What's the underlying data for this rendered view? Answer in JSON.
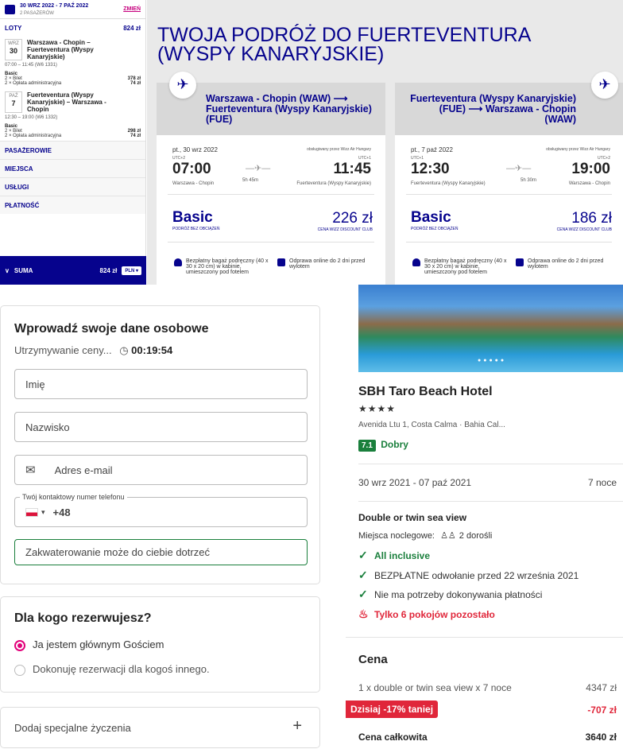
{
  "sidebar": {
    "dates": "30 WRZ 2022 - 7 PAŹ 2022",
    "passengers": "2 PASAŻERÓW",
    "change": "ZMIEŃ",
    "flights_label": "LOTY",
    "flights_total": "824 zł",
    "out": {
      "day_name": "WRZ",
      "day": "30",
      "route": "Warszawa - Chopin – Fuerteventura (Wyspy Kanaryjskie)",
      "time": "07:00 – 11:45 (W6 1331)",
      "fare": "Basic",
      "ticket": "2 × Bilet",
      "ticket_price": "378 zł",
      "fee": "2 × Opłata administracyjna",
      "fee_price": "74 zł"
    },
    "ret": {
      "day_name": "PAŹ",
      "day": "7",
      "route": "Fuerteventura (Wyspy Kanaryjskie) – Warszawa - Chopin",
      "time": "12:30 – 19:00 (W6 1332)",
      "fare": "Basic",
      "ticket": "2 × Bilet",
      "ticket_price": "298 zł",
      "fee": "2 × Opłata administracyjna",
      "fee_price": "74 zł"
    },
    "sections": [
      "PASAŻEROWIE",
      "MIEJSCA",
      "USŁUGI",
      "PŁATNOŚĆ"
    ],
    "sum_label": "SUMA",
    "sum_value": "824 zł",
    "currency": "PLN"
  },
  "trip": {
    "title": "TWOJA PODRÓŻ DO FUERTEVENTURA (WYSPY KANARYJSKIE)",
    "cards": [
      {
        "route": "Warszawa - Chopin (WAW) ⟶ Fuerteventura (Wyspy Kanaryjskie) (FUE)",
        "date": "pt., 30 wrz 2022",
        "operator": "obsługiwany przez Wizz Air Hungary",
        "tz1": "UTC+2",
        "tz2": "UTC+1",
        "dep": "07:00",
        "arr": "11:45",
        "from": "Warszawa - Chopin",
        "duration": "5h 45m",
        "to": "Fuerteventura (Wyspy Kanaryjskie)",
        "fare": "Basic",
        "fare_sub": "PODRÓŻ BEZ OBCIĄŻEŃ",
        "price": "226 zł",
        "club": "CENA WIZZ DISCOUNT CLUB",
        "bag": "Bezpłatny bagaż podręczny (40 x 30 x 20 cm) w kabinie, umieszczony pod fotelem",
        "checkin": "Odprawa online do 2 dni przed wylotem"
      },
      {
        "route": "Fuerteventura (Wyspy Kanaryjskie) (FUE) ⟶ Warszawa - Chopin (WAW)",
        "date": "pt., 7 paź 2022",
        "operator": "obsługiwany przez Wizz Air Hungary",
        "tz1": "UTC+1",
        "tz2": "UTC+2",
        "dep": "12:30",
        "arr": "19:00",
        "from": "Fuerteventura (Wyspy Kanaryjskie)",
        "duration": "5h 30m",
        "to": "Warszawa - Chopin",
        "fare": "Basic",
        "fare_sub": "PODRÓŻ BEZ OBCIĄŻEŃ",
        "price": "186 zł",
        "club": "CENA WIZZ DISCOUNT CLUB",
        "bag": "Bezpłatny bagaż podręczny (40 x 30 x 20 cm) w kabinie, umieszczony pod fotelem",
        "checkin": "Odprawa online do 2 dni przed wylotem"
      }
    ]
  },
  "form": {
    "title": "Wprowadź swoje dane osobowe",
    "hold": "Utrzymywanie ceny...",
    "timer": "00:19:54",
    "first_name": "Imię",
    "last_name": "Nazwisko",
    "email": "Adres e-mail",
    "phone_label": "Twój kontaktowy numer telefonu",
    "phone_prefix": "+48",
    "notice": "Zakwaterowanie może do ciebie dotrzeć",
    "who_title": "Dla kogo rezerwujesz?",
    "opt1": "Ja jestem głównym Gościem",
    "opt2": "Dokonuję rezerwacji dla kogoś innego.",
    "special": "Dodaj specjalne życzenia",
    "plus": "+"
  },
  "hotel": {
    "name": "SBH Taro Beach Hotel",
    "stars": "★★★★",
    "address": "Avenida Ltu 1, Costa Calma · Bahia Cal...",
    "score": "7.1",
    "score_label": "Dobry",
    "dates": "30 wrz 2021 - 07 paź 2021",
    "nights": "7 noce",
    "room": "Double or twin sea view",
    "occ_label": "Miejsca noclegowe:",
    "occ": "2 dorośli",
    "f1": "All inclusive",
    "f2": "BEZPŁATNE odwołanie przed 22 września 2021",
    "f3": "Nie ma potrzeby dokonywania płatności",
    "f4": "Tylko 6 pokojów pozostało",
    "price_title": "Cena",
    "line1": "1 x double or twin sea view x 7 noce",
    "line1_val": "4347 zł",
    "disc": "Dzisiaj -17% taniej",
    "disc_val": "-707 zł",
    "total": "Cena całkowita",
    "total_val": "3640 zł"
  },
  "colors": {
    "wizz_blue": "#06038d",
    "pink": "#c6007e",
    "green": "#1a7f3c",
    "red": "#e0263a"
  }
}
